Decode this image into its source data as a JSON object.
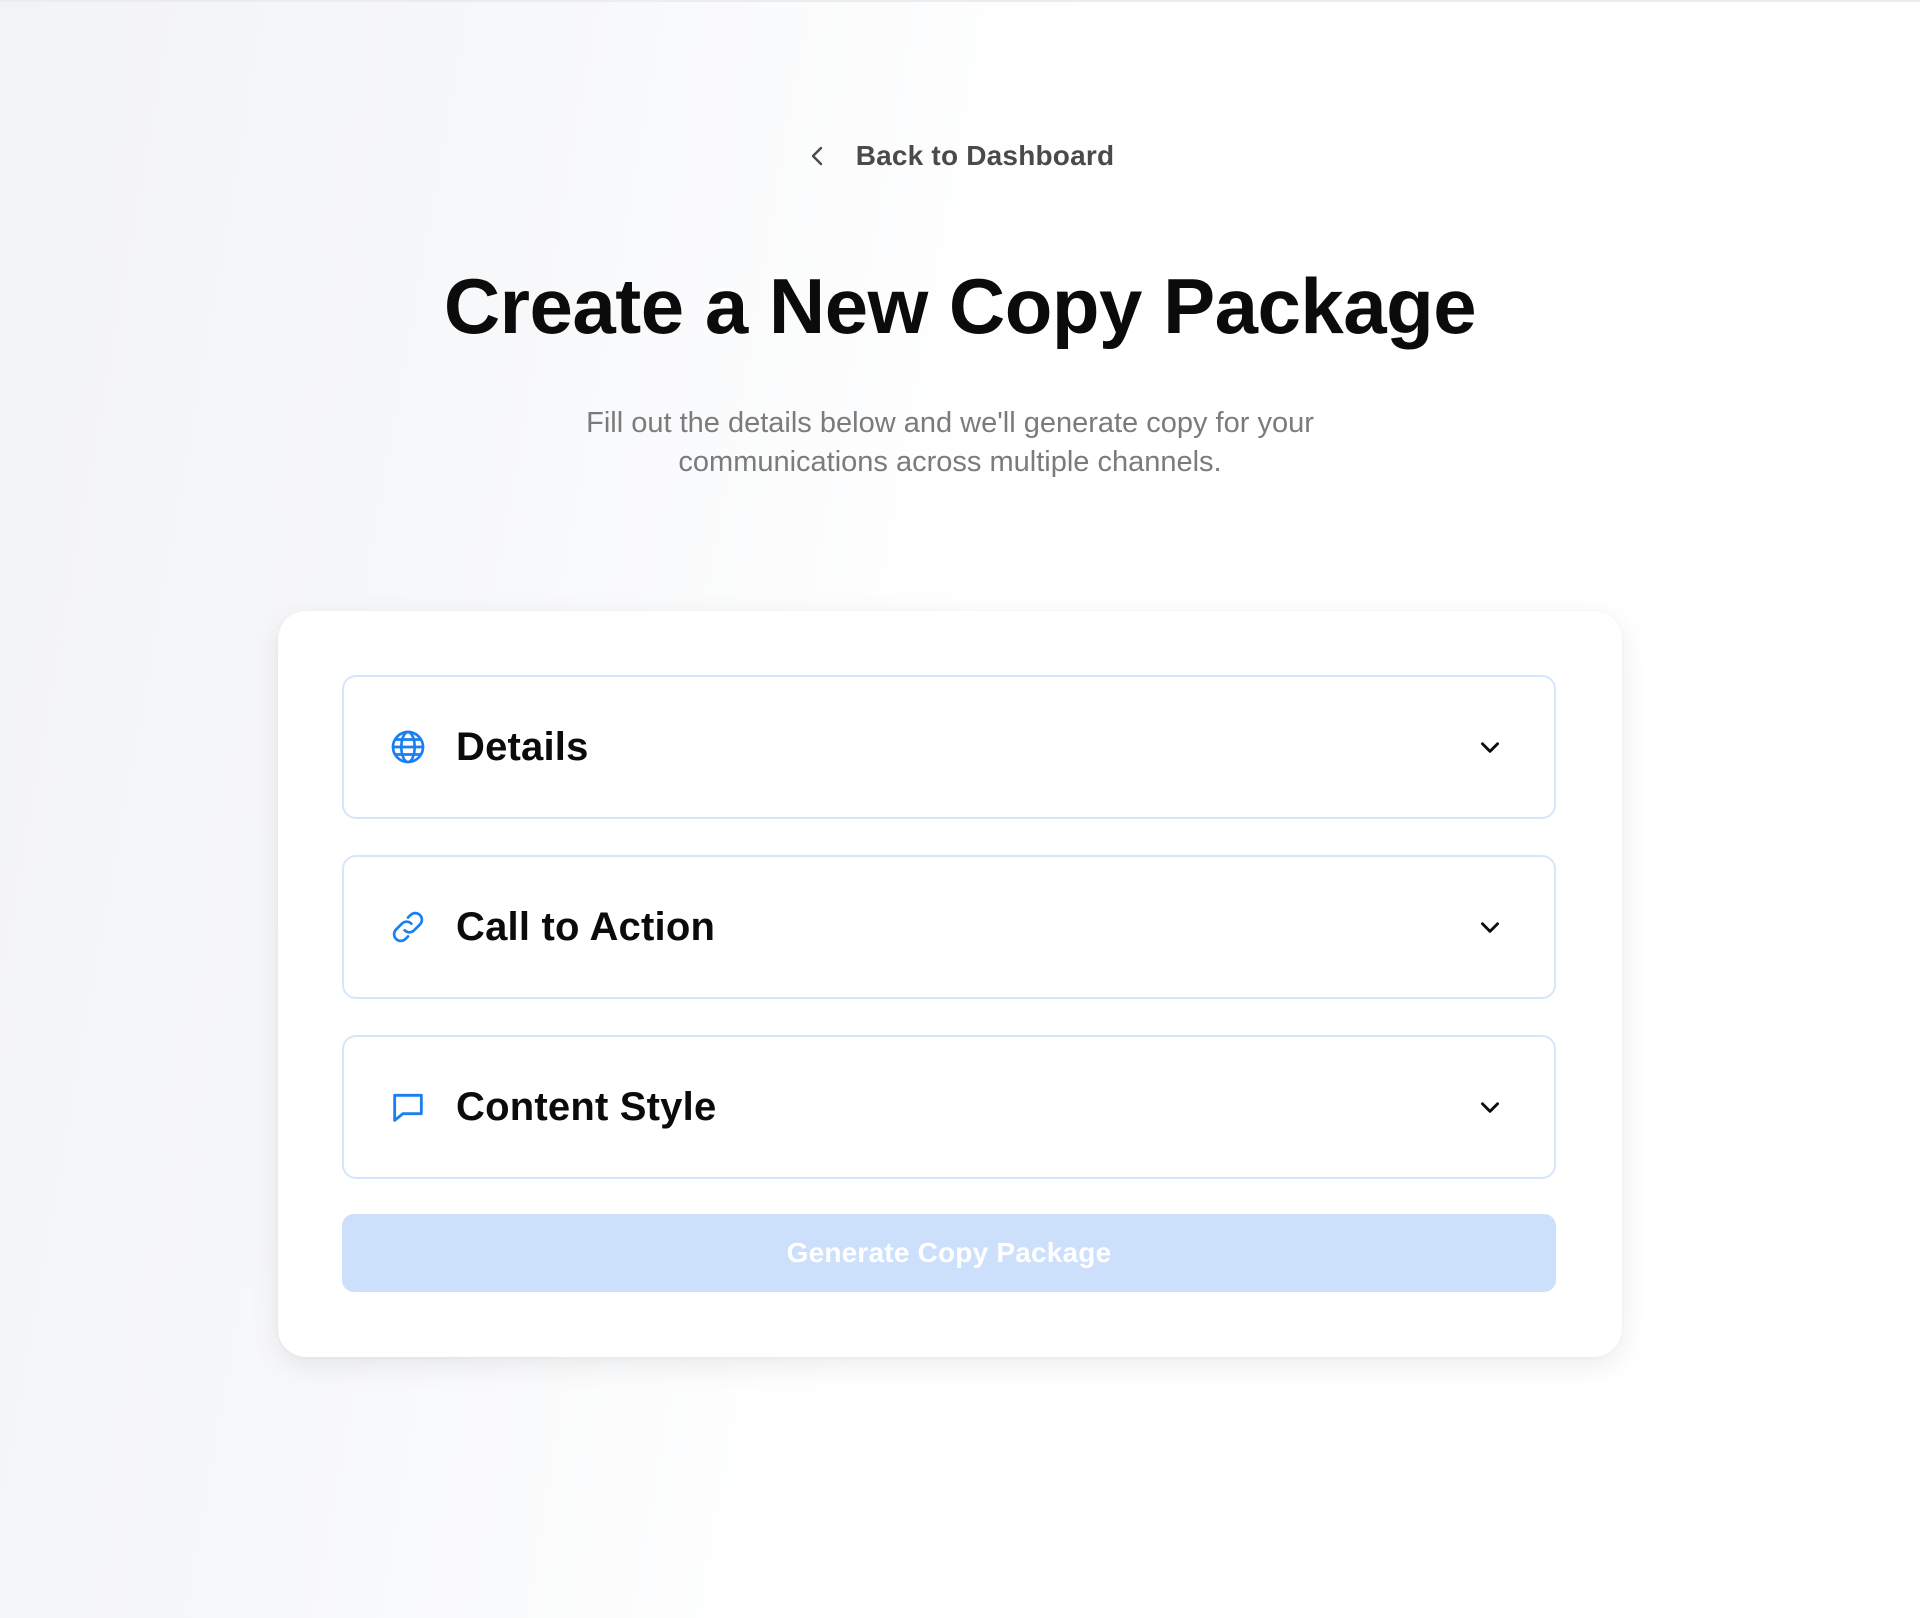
{
  "nav": {
    "back_label": "Back to Dashboard"
  },
  "header": {
    "title": "Create a New Copy Package",
    "subtitle_line1": "Fill out the details below and we'll generate copy for your",
    "subtitle_line2": "communications across multiple channels."
  },
  "sections": [
    {
      "label": "Details",
      "icon": "globe-icon",
      "expanded": false
    },
    {
      "label": "Call to Action",
      "icon": "link-icon",
      "expanded": false
    },
    {
      "label": "Content Style",
      "icon": "chat-bubble-icon",
      "expanded": false
    }
  ],
  "actions": {
    "generate_label": "Generate Copy Package",
    "generate_disabled": true
  },
  "colors": {
    "accent": "#1a7ff0",
    "section_border": "#d6e6fb",
    "button_disabled_bg": "#cce0fc",
    "title": "#0b0b0b",
    "subtitle": "#7b7b7b"
  }
}
